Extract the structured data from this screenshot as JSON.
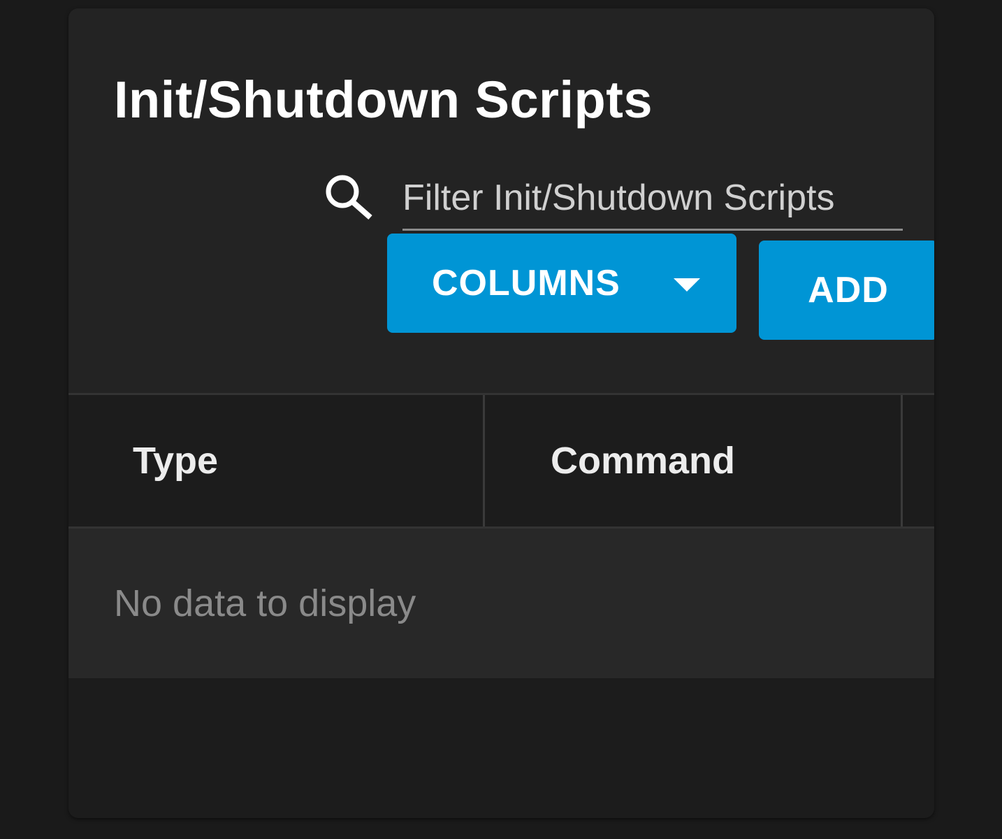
{
  "page": {
    "title": "Init/Shutdown Scripts"
  },
  "search": {
    "placeholder": "Filter Init/Shutdown Scripts",
    "value": "",
    "icon": "search-icon"
  },
  "toolbar": {
    "columns_label": "COLUMNS",
    "columns_icon": "caret-down-icon",
    "add_label": "ADD"
  },
  "table": {
    "columns": [
      {
        "label": "Type"
      },
      {
        "label": "Command"
      }
    ],
    "empty_message": "No data to display"
  },
  "colors": {
    "accent": "#0095d5",
    "background": "#1a1a1a",
    "card": "#232323",
    "text": "#ffffff"
  }
}
